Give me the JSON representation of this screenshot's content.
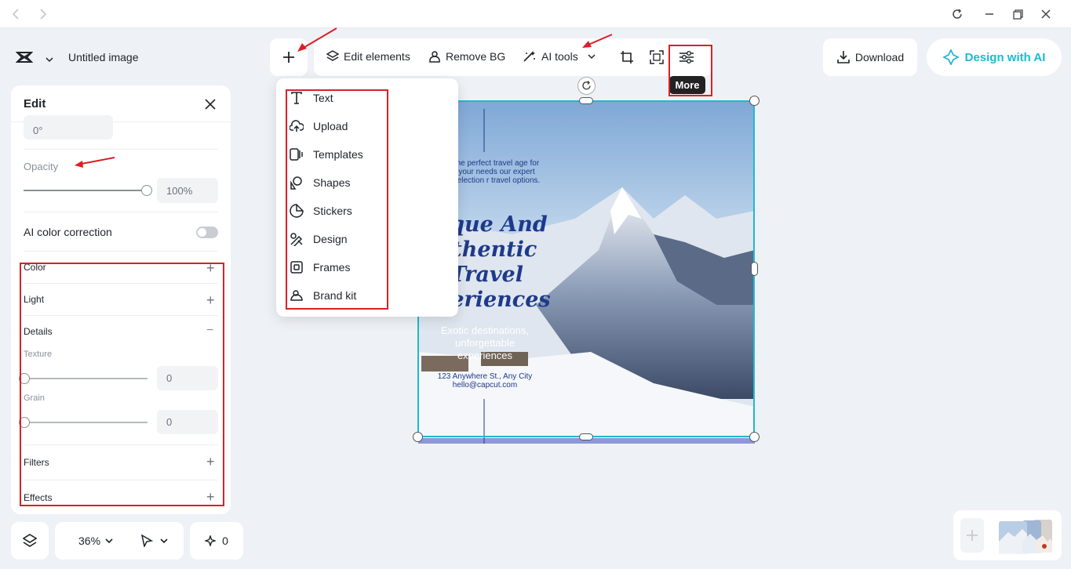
{
  "app": {
    "title": "Untitled image"
  },
  "toolbar": {
    "edit_elements": "Edit elements",
    "remove_bg": "Remove BG",
    "ai_tools": "AI tools",
    "more_tooltip": "More"
  },
  "header_right": {
    "download": "Download",
    "design_with_ai": "Design with AI"
  },
  "edit_panel": {
    "title": "Edit",
    "rotation_value": "0°",
    "opacity_label": "Opacity",
    "opacity_value": "100%",
    "opacity_level": 1.0,
    "ai_color_correction": "AI color correction",
    "sections": {
      "color": "Color",
      "light": "Light",
      "details": "Details",
      "texture": "Texture",
      "texture_value": "0",
      "grain": "Grain",
      "grain_value": "0",
      "filters": "Filters",
      "effects": "Effects"
    }
  },
  "add_menu": {
    "items": [
      {
        "label": "Text",
        "icon": "text-icon"
      },
      {
        "label": "Upload",
        "icon": "upload-icon"
      },
      {
        "label": "Templates",
        "icon": "templates-icon"
      },
      {
        "label": "Shapes",
        "icon": "shapes-icon"
      },
      {
        "label": "Stickers",
        "icon": "stickers-icon"
      },
      {
        "label": "Design",
        "icon": "design-icon"
      },
      {
        "label": "Frames",
        "icon": "frames-icon"
      },
      {
        "label": "Brand kit",
        "icon": "brand-kit-icon"
      }
    ]
  },
  "poster": {
    "intro": "the perfect travel age for your needs our expert selection r travel options.",
    "heading_lines": [
      "nique And",
      "uthentic",
      "Travel",
      "xperiences"
    ],
    "subtitle": "Exotic destinations, unforgettable experiences",
    "address": "123 Anywhere St., Any City",
    "email": "hello@capcut.com"
  },
  "bottom_bar": {
    "zoom": "36%",
    "sparkle_count": "0"
  },
  "colors": {
    "accent": "#1fb8cf",
    "annotation_red": "#d92027",
    "poster_text": "#1e3a8a"
  }
}
